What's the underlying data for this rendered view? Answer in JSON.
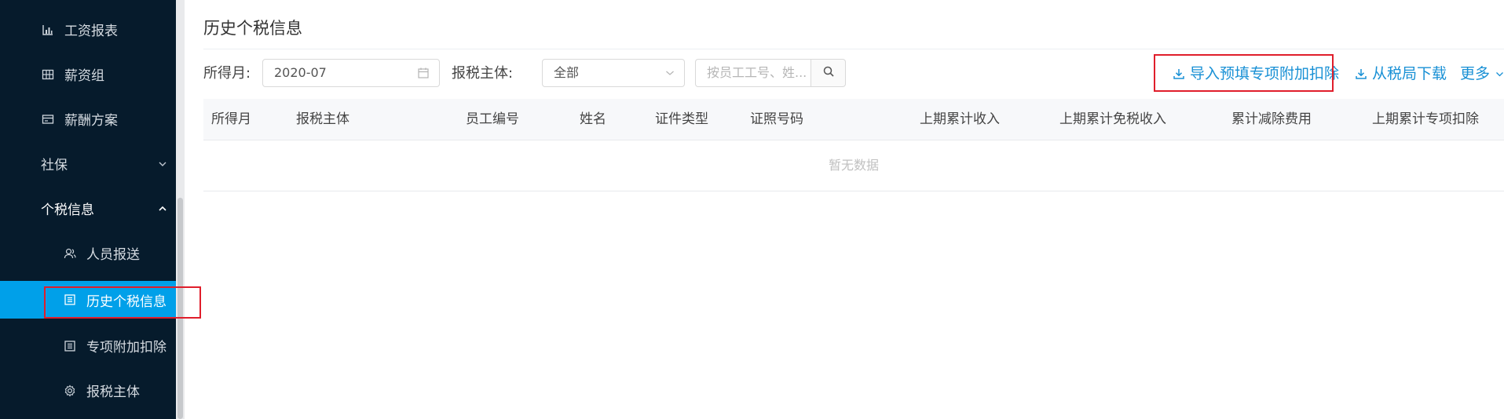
{
  "sidebar": {
    "items": [
      {
        "label": "工资报表",
        "icon": "bar-chart-icon"
      },
      {
        "label": "薪资组",
        "icon": "grid-icon"
      },
      {
        "label": "薪酬方案",
        "icon": "card-icon"
      },
      {
        "label": "社保",
        "icon": "chevron-down-icon"
      },
      {
        "label": "个税信息",
        "icon": "chevron-up-icon"
      },
      {
        "label": "人员报送",
        "icon": "users-icon"
      },
      {
        "label": "历史个税信息",
        "icon": "document-icon"
      },
      {
        "label": "专项附加扣除",
        "icon": "document-icon"
      },
      {
        "label": "报税主体",
        "icon": "gear-icon"
      }
    ]
  },
  "page": {
    "title": "历史个税信息"
  },
  "filters": {
    "month_label": "所得月:",
    "month_value": "2020-07",
    "entity_label": "报税主体:",
    "entity_value": "全部",
    "search_placeholder": "按员工工号、姓..."
  },
  "actions": {
    "import_label": "导入预填专项附加扣除",
    "download_label": "从税局下载",
    "more_label": "更多"
  },
  "table": {
    "columns": [
      "所得月",
      "报税主体",
      "员工编号",
      "姓名",
      "证件类型",
      "证照号码",
      "上期累计收入",
      "上期累计免税收入",
      "累计减除费用",
      "上期累计专项扣除"
    ],
    "empty_text": "暂无数据"
  },
  "colors": {
    "accent": "#1890d5",
    "sidebar_bg": "#061b2c",
    "active_bg": "#00a0e9",
    "highlight": "#e01e2b"
  }
}
